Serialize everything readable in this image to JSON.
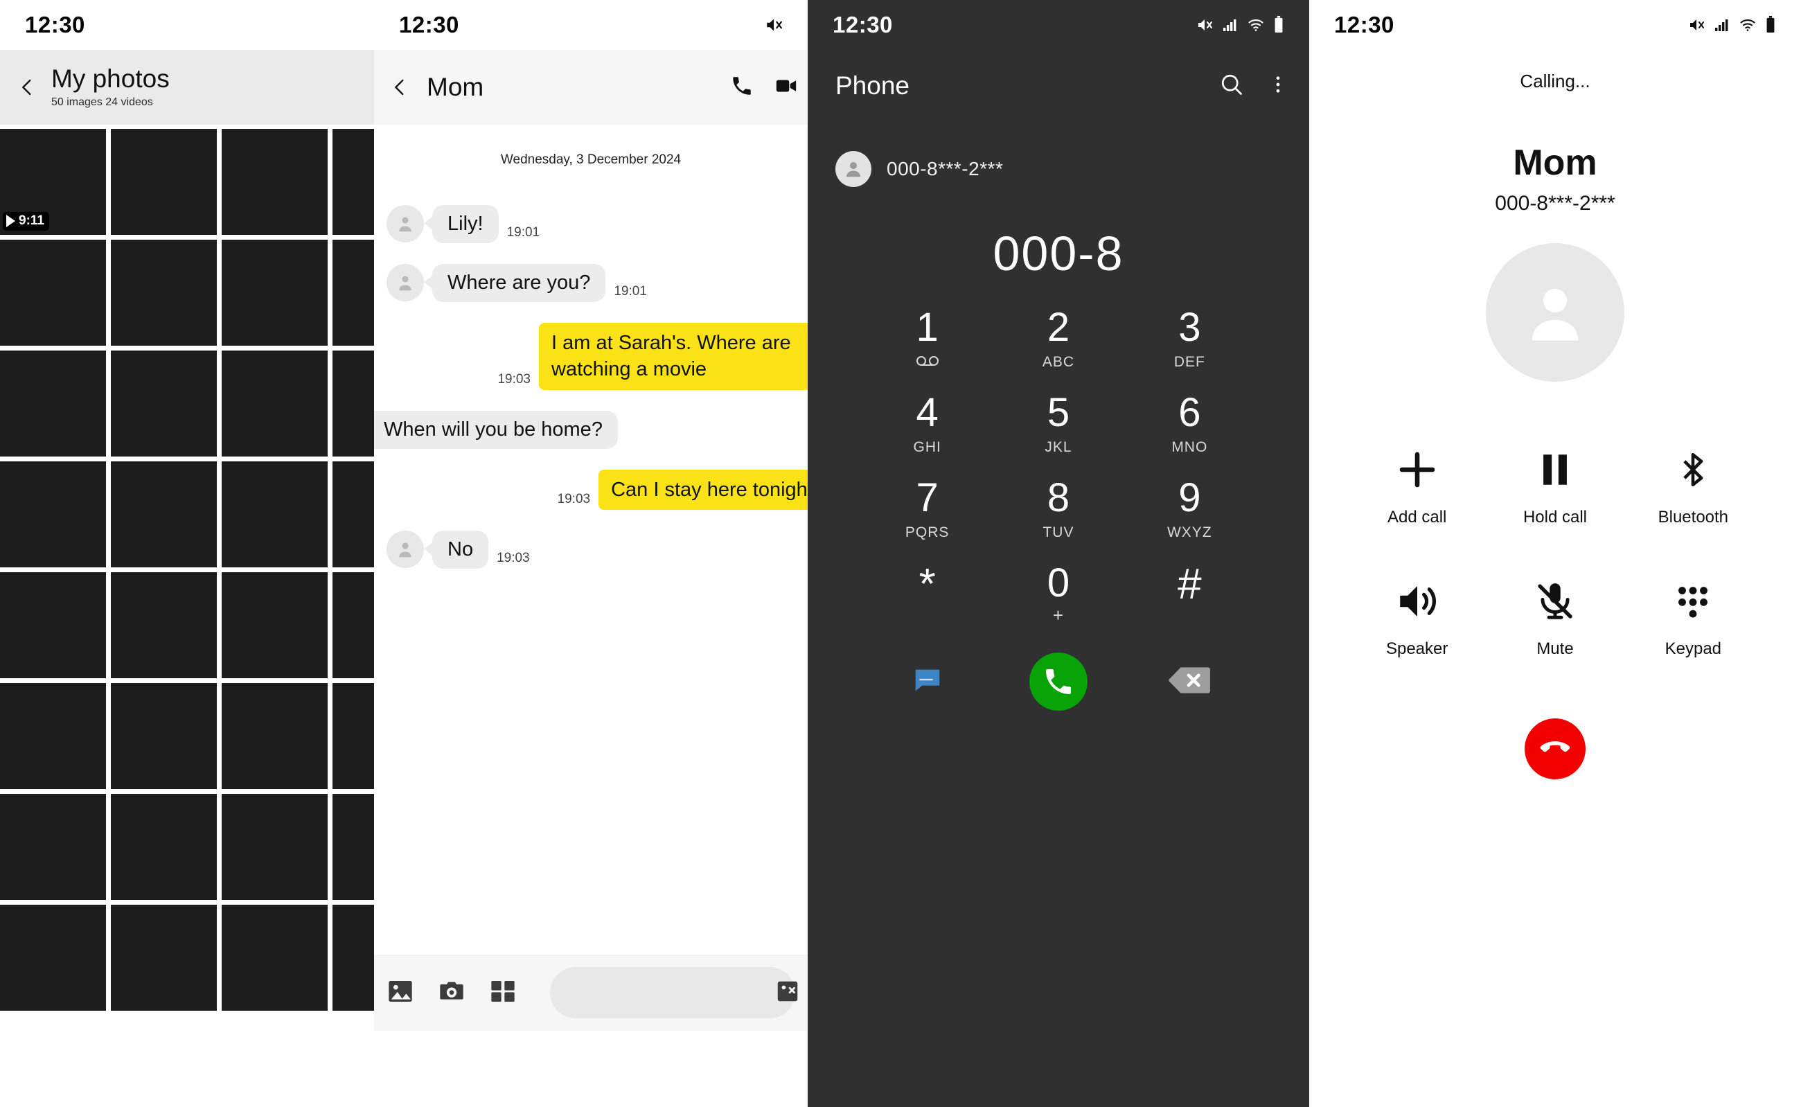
{
  "photos": {
    "status": {
      "time": "12:30",
      "icons": []
    },
    "back_icon": "chevron-left-icon",
    "title": "My photos",
    "subtitle": "50 images 24 videos",
    "video_badge": {
      "play_icon": "play-icon",
      "duration": "9:11"
    },
    "grid": {
      "columns": 4,
      "rows": 8,
      "cell_count": 32
    }
  },
  "chat": {
    "status": {
      "time": "12:30",
      "icons": [
        "mute-icon"
      ]
    },
    "back_icon": "chevron-left-icon",
    "title": "Mom",
    "header_icons": [
      "phone-call-icon",
      "video-call-icon"
    ],
    "date_separator": "Wednesday, 3 December 2024",
    "messages": [
      {
        "dir": "in",
        "text": "Lily!",
        "time": "19:01"
      },
      {
        "dir": "in",
        "text": "Where are you?",
        "time": "19:01"
      },
      {
        "dir": "out",
        "text": "I am at Sarah's. Where are watching a movie",
        "time": "19:03"
      },
      {
        "dir": "in",
        "text": "When will you be home?",
        "time": ""
      },
      {
        "dir": "out",
        "text": "Can I stay here tonight?",
        "time": "19:03"
      },
      {
        "dir": "in",
        "text": "No",
        "time": "19:03"
      }
    ],
    "footer": {
      "icons": [
        "gallery-icon",
        "camera-icon",
        "apps-grid-icon"
      ],
      "input_placeholder": "",
      "input_value": "",
      "send_icon": "sticker-icon"
    }
  },
  "dialer": {
    "status": {
      "time": "12:30",
      "icons": [
        "mute-icon",
        "signal-icon",
        "wifi-icon",
        "battery-icon"
      ]
    },
    "title": "Phone",
    "header_icons": [
      "search-icon",
      "more-vertical-icon"
    ],
    "recent_number": "000-8***-2***",
    "display_number": "000-8",
    "keys": [
      {
        "num": "1",
        "sub": ""
      },
      {
        "num": "2",
        "sub": "ABC"
      },
      {
        "num": "3",
        "sub": "DEF"
      },
      {
        "num": "4",
        "sub": "GHI"
      },
      {
        "num": "5",
        "sub": "JKL"
      },
      {
        "num": "6",
        "sub": "MNO"
      },
      {
        "num": "7",
        "sub": "PQRS"
      },
      {
        "num": "8",
        "sub": "TUV"
      },
      {
        "num": "9",
        "sub": "WXYZ"
      },
      {
        "num": "*",
        "sub": ""
      },
      {
        "num": "0",
        "sub": "+"
      },
      {
        "num": "#",
        "sub": ""
      }
    ],
    "actions": {
      "message_icon": "message-bubble-icon",
      "call_icon": "phone-handset-icon",
      "backspace_icon": "backspace-icon",
      "call_color": "#07a307"
    }
  },
  "calling": {
    "status": {
      "time": "12:30",
      "icons": [
        "mute-icon",
        "signal-icon",
        "wifi-icon",
        "battery-icon"
      ]
    },
    "state": "Calling...",
    "name": "Mom",
    "number": "000-8***-2***",
    "avatar_icon": "person-icon",
    "buttons": [
      {
        "label": "Add call",
        "icon": "plus-icon"
      },
      {
        "label": "Hold call",
        "icon": "pause-icon"
      },
      {
        "label": "Bluetooth",
        "icon": "bluetooth-icon"
      },
      {
        "label": "Speaker",
        "icon": "speaker-icon"
      },
      {
        "label": "Mute",
        "icon": "mic-off-icon"
      },
      {
        "label": "Keypad",
        "icon": "keypad-dots-icon"
      }
    ],
    "end_call": {
      "icon": "phone-hangup-icon",
      "color": "#f20000"
    }
  }
}
